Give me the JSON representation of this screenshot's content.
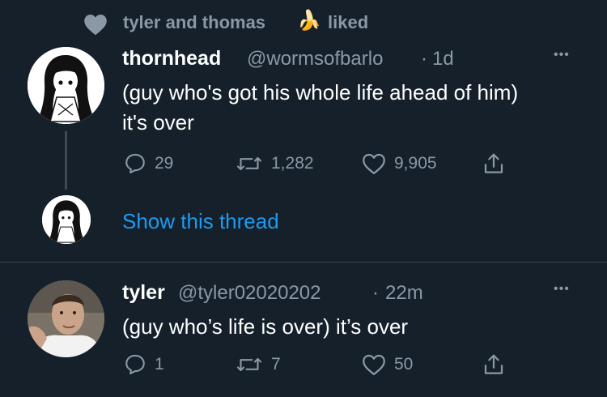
{
  "social_context": {
    "names": "tyler and thomas",
    "emoji": "🍌",
    "action": "liked",
    "icon": "heart-icon"
  },
  "tweets": [
    {
      "display_name": "thornhead",
      "handle": "@wormsofbarlo",
      "separator": "·",
      "time": "1d",
      "text_line1": "(guy who's got his whole life ahead of him)",
      "text_line2": "it's over",
      "replies": "29",
      "retweets": "1,282",
      "likes": "9,905",
      "more": "•••"
    },
    {
      "display_name": "tyler",
      "handle": "@tyler02020202",
      "separator": "·",
      "time": "22m",
      "text_line1": "(guy who’s life is over) it’s over",
      "replies": "1",
      "retweets": "7",
      "likes": "50",
      "more": "•••"
    }
  ],
  "thread": {
    "show_label": "Show this thread"
  },
  "colors": {
    "background": "#15202b",
    "text": "#ffffff",
    "muted": "#8b98a5",
    "link": "#1d9bf0",
    "divider": "#38444d"
  }
}
